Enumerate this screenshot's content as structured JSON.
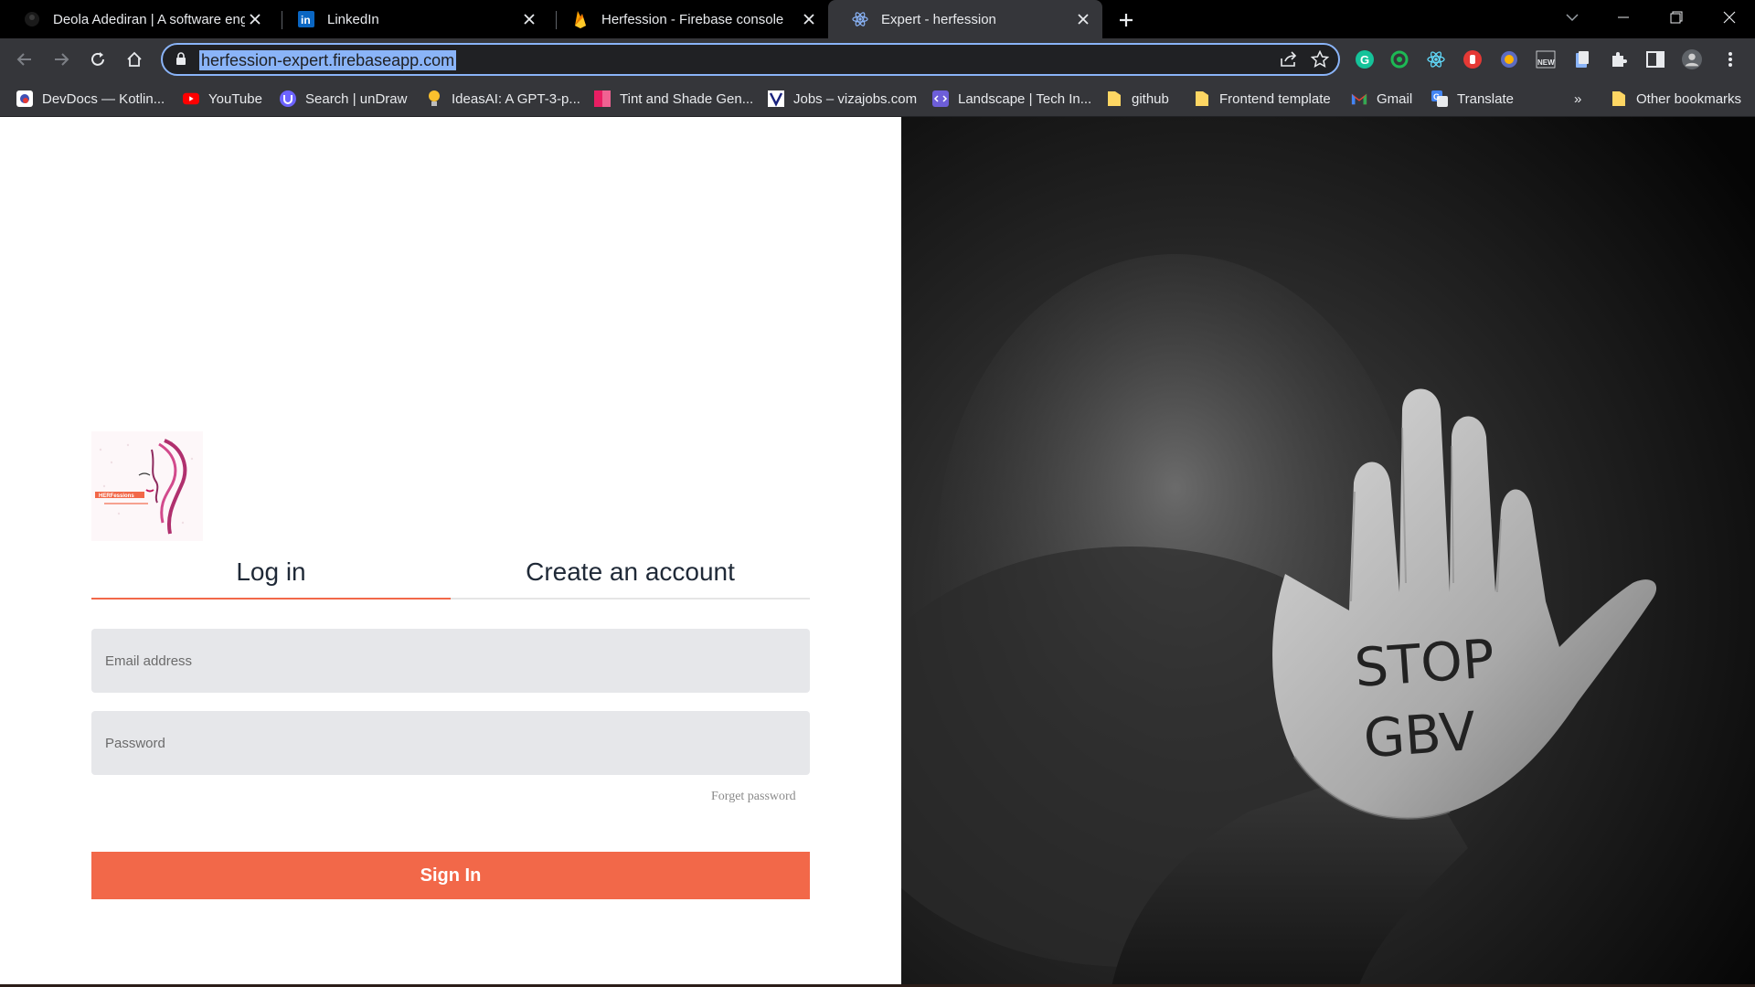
{
  "browser": {
    "tabs": [
      {
        "title": "Deola Adediran | A software engi",
        "icon": "profile-avatar-icon",
        "active": false
      },
      {
        "title": "LinkedIn",
        "icon": "linkedin-icon",
        "active": false
      },
      {
        "title": "Herfession - Firebase console",
        "icon": "firebase-icon",
        "active": false
      },
      {
        "title": "Expert - herfession",
        "icon": "react-icon",
        "active": true
      }
    ],
    "url": "herfession-expert.firebaseapp.com",
    "bookmarks": [
      {
        "label": "DevDocs — Kotlin...",
        "icon": "devdocs-icon"
      },
      {
        "label": "YouTube",
        "icon": "youtube-icon"
      },
      {
        "label": "Search | unDraw",
        "icon": "undraw-icon"
      },
      {
        "label": "IdeasAI: A GPT-3-p...",
        "icon": "lightbulb-icon"
      },
      {
        "label": "Tint and Shade Gen...",
        "icon": "tint-icon"
      },
      {
        "label": "Jobs – vizajobs.com",
        "icon": "vizajobs-icon"
      },
      {
        "label": "Landscape | Tech In...",
        "icon": "code-icon"
      },
      {
        "label": "github",
        "icon": "folder-icon"
      },
      {
        "label": "Frontend template",
        "icon": "folder-icon"
      },
      {
        "label": "Gmail",
        "icon": "gmail-icon"
      },
      {
        "label": "Translate",
        "icon": "translate-icon"
      }
    ],
    "more_bookmarks": "»",
    "other_bookmarks": "Other bookmarks",
    "colors": {
      "accent": "#8ab4f8",
      "toolbar": "#35363a",
      "tabstrip": "#000000"
    }
  },
  "auth": {
    "tab_login": "Log in",
    "tab_create": "Create an account",
    "email_placeholder": "Email address",
    "password_placeholder": "Password",
    "forget_password": "Forget password",
    "sign_in": "Sign In",
    "logo_text": "HERFessions",
    "colors": {
      "primary": "#f26849",
      "field_bg": "#e6e7ea"
    }
  },
  "hero": {
    "hand_text_line1": "STOP",
    "hand_text_line2": "GBV"
  }
}
